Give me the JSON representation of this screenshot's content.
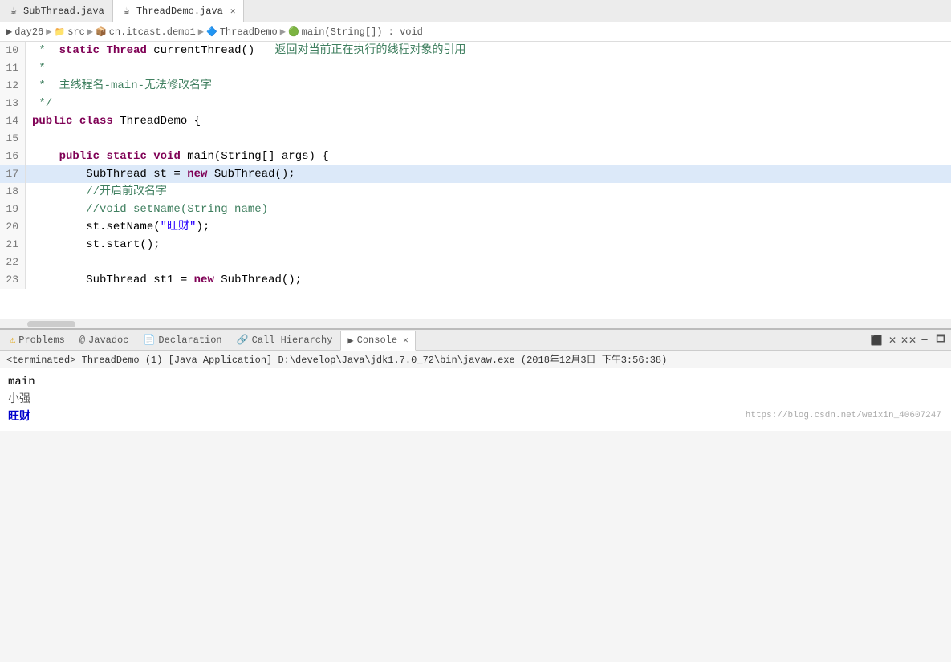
{
  "tabs": [
    {
      "id": "subthread",
      "label": "SubThread.java",
      "icon": "☕",
      "active": false,
      "closeable": false
    },
    {
      "id": "threaddemo",
      "label": "ThreadDemo.java",
      "icon": "☕",
      "active": true,
      "closeable": true
    }
  ],
  "breadcrumb": {
    "items": [
      "day26",
      "src",
      "cn.itcast.demo1",
      "ThreadDemo",
      "main(String[]) : void"
    ]
  },
  "code": {
    "lines": [
      {
        "num": 10,
        "highlighted": false,
        "content": " *  static Thread currentThread()   返回对当前正在执行的线程对象的引用",
        "type": "comment"
      },
      {
        "num": 11,
        "highlighted": false,
        "content": " *",
        "type": "comment"
      },
      {
        "num": 12,
        "highlighted": false,
        "content": " *  主线程名-main-无法修改名字",
        "type": "comment"
      },
      {
        "num": 13,
        "highlighted": false,
        "content": " */",
        "type": "comment"
      },
      {
        "num": 14,
        "highlighted": false,
        "content": "public class ThreadDemo {",
        "type": "class_decl"
      },
      {
        "num": 15,
        "highlighted": false,
        "content": "",
        "type": "blank"
      },
      {
        "num": 16,
        "highlighted": false,
        "content": "    public static void main(String[] args) {",
        "type": "method_decl"
      },
      {
        "num": 17,
        "highlighted": true,
        "content": "        SubThread st = new SubThread();",
        "type": "code"
      },
      {
        "num": 18,
        "highlighted": false,
        "content": "        //开启前改名字",
        "type": "inline_comment"
      },
      {
        "num": 19,
        "highlighted": false,
        "content": "        //void setName(String name)",
        "type": "inline_comment"
      },
      {
        "num": 20,
        "highlighted": false,
        "content": "        st.setName(\"旺财\");",
        "type": "code"
      },
      {
        "num": 21,
        "highlighted": false,
        "content": "        st.start();",
        "type": "code"
      },
      {
        "num": 22,
        "highlighted": false,
        "content": "",
        "type": "blank"
      },
      {
        "num": 23,
        "highlighted": false,
        "content": "        SubThread st1 = new SubThread();",
        "type": "code"
      }
    ]
  },
  "bottom_panel": {
    "tabs": [
      {
        "id": "problems",
        "label": "Problems",
        "icon": "⚠",
        "active": false
      },
      {
        "id": "javadoc",
        "label": "Javadoc",
        "icon": "@",
        "active": false
      },
      {
        "id": "declaration",
        "label": "Declaration",
        "icon": "📄",
        "active": false
      },
      {
        "id": "callhierarchy",
        "label": "Call Hierarchy",
        "icon": "🔗",
        "active": false
      },
      {
        "id": "console",
        "label": "Console",
        "icon": "▶",
        "active": true
      }
    ],
    "console": {
      "status": "<terminated> ThreadDemo (1) [Java Application] D:\\develop\\Java\\jdk1.7.0_72\\bin\\javaw.exe (2018年12月3日 下午3:56:38)",
      "output": [
        {
          "text": "main",
          "color": "black"
        },
        {
          "text": "小强",
          "color": "black"
        },
        {
          "text": "旺财",
          "color": "blue"
        }
      ]
    }
  },
  "watermark": "https://blog.csdn.net/weixin_40607247"
}
